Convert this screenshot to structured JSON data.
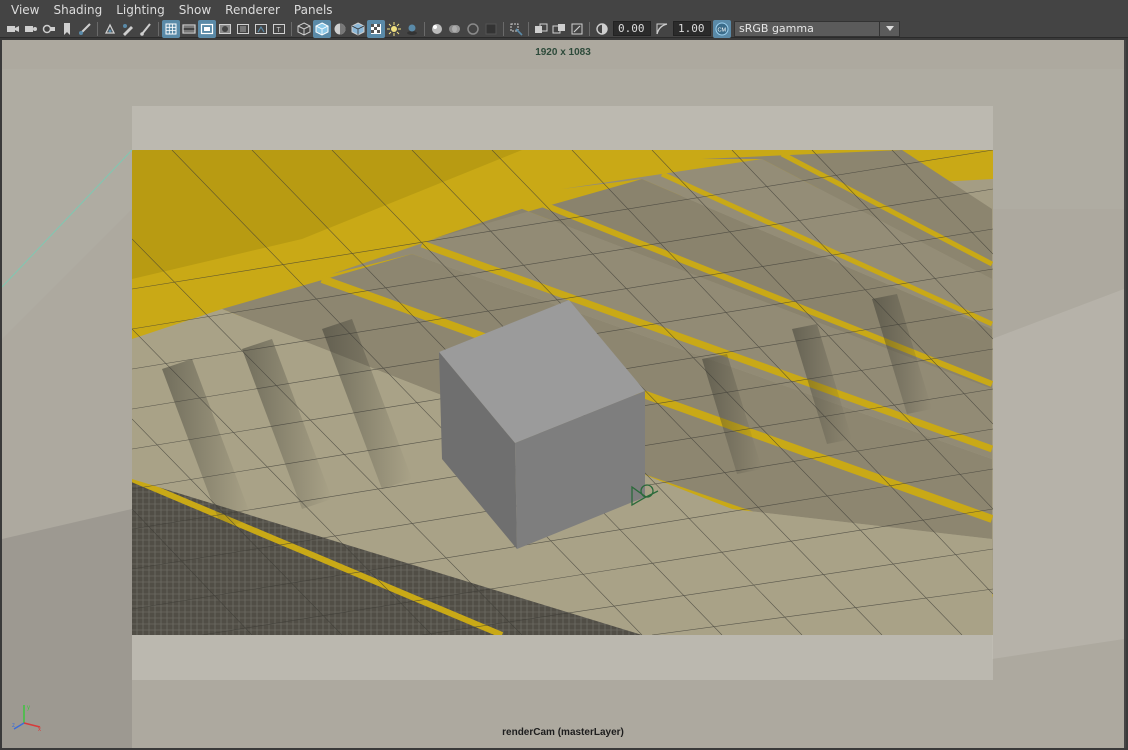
{
  "menu": [
    "View",
    "Shading",
    "Lighting",
    "Show",
    "Renderer",
    "Panels"
  ],
  "toolbar": {
    "exposure_value": "0.00",
    "gamma_value": "1.00",
    "color_space": "sRGB gamma"
  },
  "viewport": {
    "resolution_label": "1920 x 1083",
    "camera_label": "renderCam (masterLayer)"
  },
  "colors": {
    "ui_bg": "#444444",
    "accent": "#5a8aa8",
    "stair_yellow": "#c9a916",
    "concrete": "#a49d84"
  }
}
